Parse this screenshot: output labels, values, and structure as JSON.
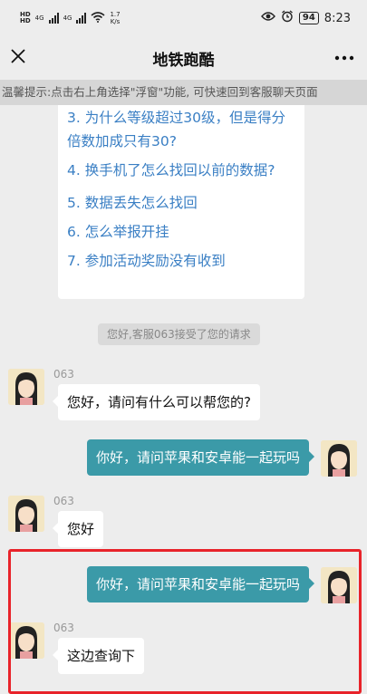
{
  "status_bar": {
    "signal1_label": "HD",
    "signal2_label": "HD",
    "net1": "4G",
    "net2": "4G",
    "speed_value": "1.7",
    "speed_unit": "K/s",
    "battery": "94",
    "time": "8:23"
  },
  "header": {
    "title": "地铁跑酷"
  },
  "notice": "温馨提示:点击右上角选择\"浮窗\"功能, 可快速回到客服聊天页面",
  "faq": {
    "items": [
      "3. 为什么等级超过30级，但是得分倍数加成只有30?",
      "4. 换手机了怎么找回以前的数据?",
      "5. 数据丢失怎么找回",
      "6. 怎么举报开挂",
      "7. 参加活动奖励没有收到"
    ],
    "link_color": "#3a7fc4"
  },
  "system_message": "您好,客服063接受了您的请求",
  "messages": [
    {
      "side": "left",
      "name": "063",
      "text": "您好，请问有什么可以帮您的?"
    },
    {
      "side": "right",
      "text": "你好，请问苹果和安卓能一起玩吗"
    },
    {
      "side": "left",
      "name": "063",
      "text": "您好"
    },
    {
      "side": "right",
      "text": "你好，请问苹果和安卓能一起玩吗"
    },
    {
      "side": "left",
      "name": "063",
      "text": "这边查询下"
    }
  ],
  "colors": {
    "right_bubble": "#3b9aa8",
    "highlight": "#e8232a"
  }
}
